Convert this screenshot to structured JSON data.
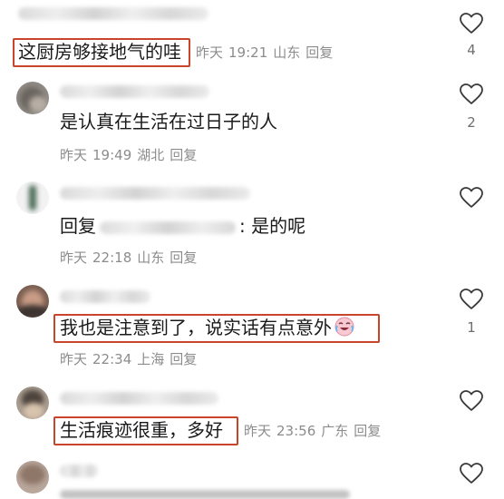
{
  "comments": [
    {
      "text": "这厨房够接地气的哇",
      "date": "昨天",
      "time": "19:21",
      "location": "山东",
      "reply_label": "回复",
      "likes": "4",
      "highlighted": true
    },
    {
      "text": "是认真在生活在过日子的人",
      "date": "昨天",
      "time": "19:49",
      "location": "湖北",
      "reply_label": "回复",
      "likes": "2"
    },
    {
      "reply_prefix": "回复",
      "text": ": 是的呢",
      "date": "昨天",
      "time": "22:18",
      "location": "山东",
      "reply_label": "回复",
      "likes": ""
    },
    {
      "text": "我也是注意到了，说实话有点意外",
      "date": "昨天",
      "time": "22:34",
      "location": "上海",
      "reply_label": "回复",
      "likes": "1",
      "highlighted": true
    },
    {
      "text": "生活痕迹很重，多好",
      "date": "昨天",
      "time": "23:56",
      "location": "广东",
      "reply_label": "回复",
      "likes": "",
      "highlighted": true
    }
  ],
  "colors": {
    "highlight_box": "#c8452b",
    "meta_text": "#8c8c8c",
    "comment_text": "#1a1a1a"
  },
  "icons": {
    "like": "heart-outline-icon",
    "emoji": "crying-laughing-emoji-icon"
  }
}
